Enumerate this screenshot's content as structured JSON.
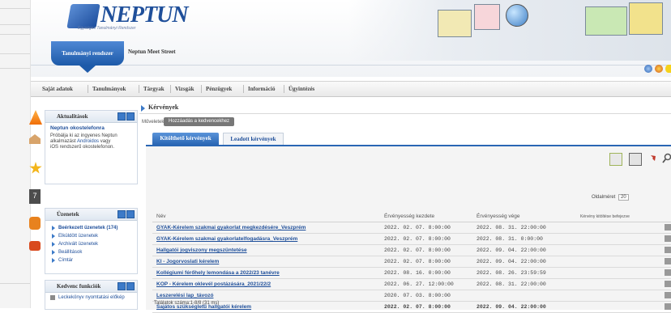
{
  "header": {
    "logo_text": "NEPTUN",
    "logo_sub": "Egységes Tanulmányi Rendszer",
    "system_tab": "Tanulmányi rendszer",
    "site_name": "Neptun Meet Street"
  },
  "menu": [
    "Saját adatok",
    "Tanulmányok",
    "Tárgyak",
    "Vizsgák",
    "Pénzügyek",
    "Információ",
    "Ügyintézés"
  ],
  "panels": {
    "news": {
      "title": "Aktualitások",
      "headline": "Neptun okostelefonra",
      "text1": "Próbálja ki az ingyenes Neptun",
      "text2": "alkalmazást",
      "link": "Androidos",
      "text3": "vagy",
      "text4": "iOS rendszerű okostelefonon."
    },
    "messages": {
      "title": "Üzenetek",
      "items": [
        "Beérkezett üzenetek (174)",
        "Elküldött üzenetek",
        "Archivált üzenetek",
        "Beállítások",
        "Címtár"
      ]
    },
    "favorites": {
      "title": "Kedvenc funkciók",
      "items": [
        "Leckekönyv nyomtatási előkép"
      ]
    }
  },
  "main": {
    "breadcrumb": "Kérvények",
    "actions_label": "Műveletek:",
    "add_fav_button": "Hozzáadás a kedvencekhez",
    "tabs": [
      "Kitölthető kérvények",
      "Leadott kérvények"
    ],
    "page_size_label": "Oldalméret",
    "page_size_value": "20",
    "columns": [
      "Név",
      "Érvényesség kezdete",
      "Érvényesség vége",
      "Kérvény kitöltése befejezve"
    ],
    "rows": [
      {
        "name": "GYAK-Kérelem szakmai gyakorlat megkezdésére_Veszprém",
        "start": "2022. 02. 07. 8:00:00",
        "end": "2022. 08. 31. 22:00:00"
      },
      {
        "name": "GYAK-Kérelem szakmai gyakorlatelfogadásra_Veszprém",
        "start": "2022. 02. 07. 8:00:00",
        "end": "2022. 08. 31. 0:00:00"
      },
      {
        "name": "Hallgatói jogviszony megszüntetése",
        "start": "2022. 02. 07. 8:00:00",
        "end": "2022. 09. 04. 22:00:00"
      },
      {
        "name": "KI - Jogorvoslati kérelem",
        "start": "2022. 02. 07. 8:00:00",
        "end": "2022. 09. 04. 22:00:00"
      },
      {
        "name": "Kollégiumi férőhely lemondása a 2022/23 tanévre",
        "start": "2022. 08. 16. 0:00:00",
        "end": "2022. 08. 26. 23:59:59"
      },
      {
        "name": "KOP - Kérelem oklevél postázására_2021/22/2",
        "start": "2022. 06. 27. 12:00:00",
        "end": "2022. 08. 31. 22:00:00"
      },
      {
        "name": "Leszerelési lap_távozó",
        "start": "2020. 07. 03. 8:00:00",
        "end": ""
      },
      {
        "name": "Sajátos szükségletű hallgatói kérelem",
        "start": "2022. 02. 07. 8:00:00",
        "end": "2022. 09. 04. 22:00:00"
      }
    ],
    "footer": "Találatok száma:1-8/8 (31 ms)"
  }
}
